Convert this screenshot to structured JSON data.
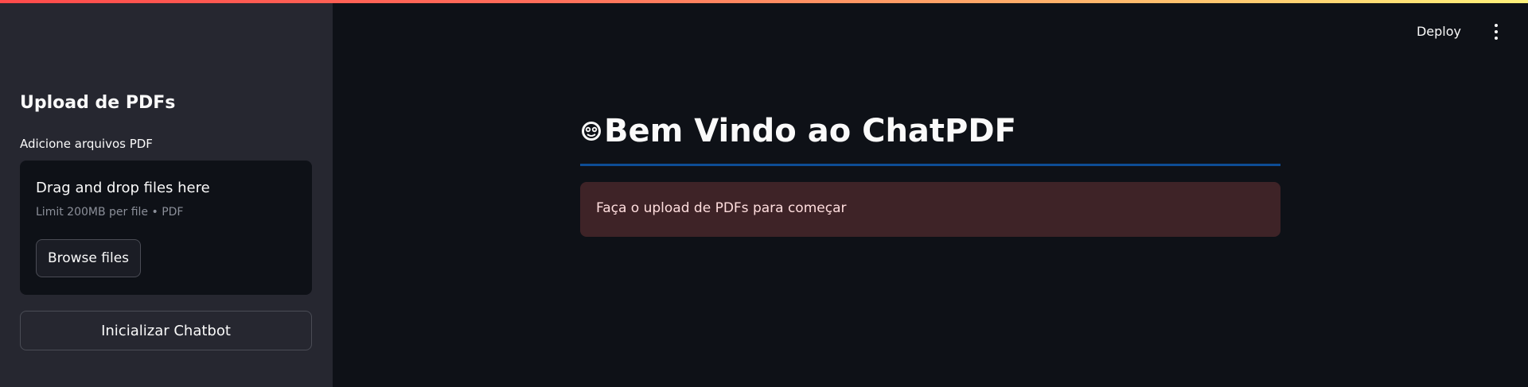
{
  "sidebar": {
    "title": "Upload de PDFs",
    "uploader": {
      "label": "Adicione arquivos PDF",
      "drop_title": "Drag and drop files here",
      "limit_text": "Limit 200MB per file • PDF",
      "browse_label": "Browse files"
    },
    "init_button_label": "Inicializar Chatbot"
  },
  "header": {
    "deploy_label": "Deploy",
    "menu_icon": "kebab-menu-icon"
  },
  "main": {
    "title_icon": "monkey-face-icon",
    "title": "Bem Vindo ao ChatPDF",
    "alert_text": "Faça o upload de PDFs para começar"
  },
  "colors": {
    "background": "#0e1117",
    "sidebar": "#262730",
    "divider": "#0d4d95",
    "alert_bg": "#3e2327",
    "alert_text": "#ffdede",
    "top_stripe_start": "#ff4b4b",
    "top_stripe_end": "#fff27a"
  }
}
